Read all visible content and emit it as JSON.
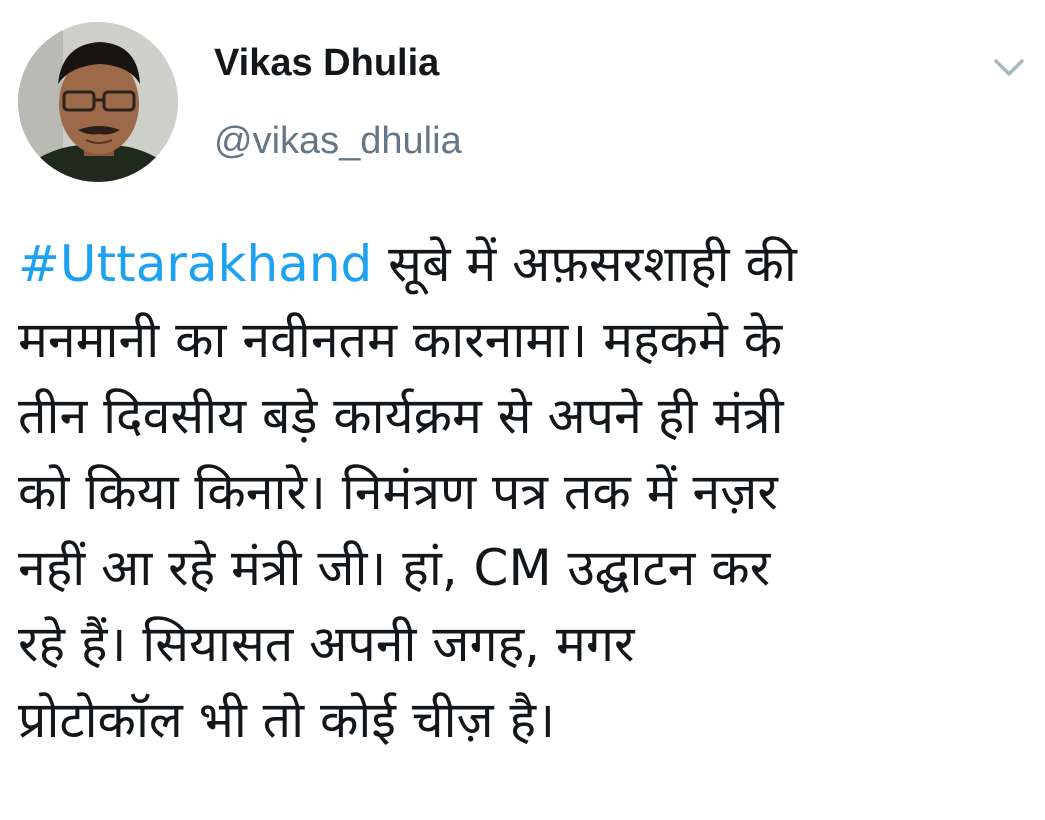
{
  "user": {
    "display_name": "Vikas Dhulia",
    "handle": "@vikas_dhulia",
    "avatar_icon": "profile-photo-avatar"
  },
  "menu": {
    "icon": "chevron-down-icon"
  },
  "tweet": {
    "hashtag": "#Uttarakhand",
    "line1_rest": " सूबे में अफ़सरशाही की",
    "lines": [
      "मनमानी का नवीनतम कारनामा। महकमे के",
      "तीन दिवसीय बड़े कार्यक्रम से अपने ही मंत्री",
      "को किया किनारे। निमंत्रण पत्र तक में नज़र",
      "नहीं आ रहे मंत्री जी। हां, CM उद्घाटन कर",
      "रहे हैं। सियासत अपनी जगह, मगर",
      "प्रोटोकॉल भी तो कोई चीज़ है।"
    ]
  },
  "colors": {
    "hashtag_blue": "#1da1f2",
    "handle_gray": "#657786",
    "text_dark": "#14171a"
  }
}
